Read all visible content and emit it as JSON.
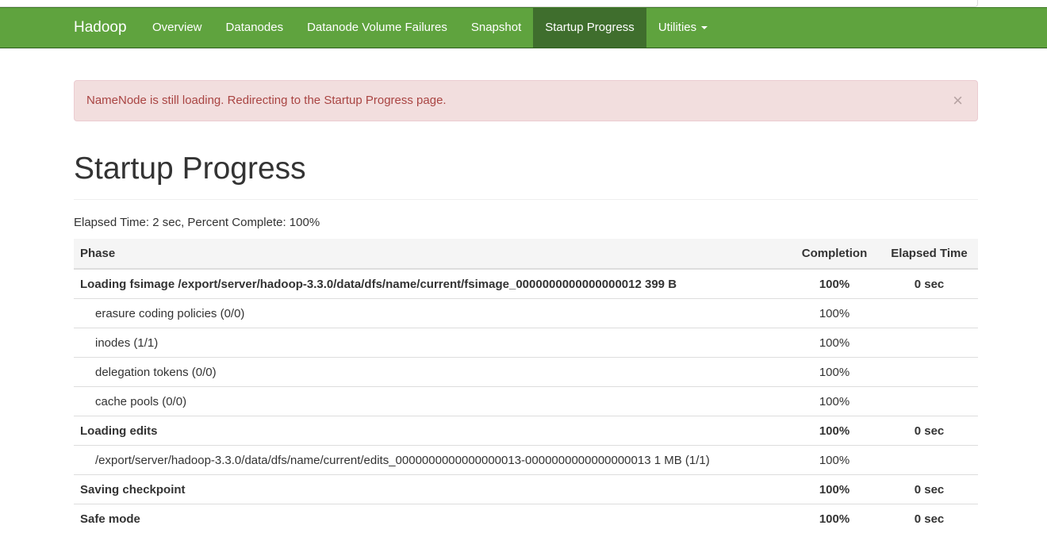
{
  "navbar": {
    "brand": "Hadoop",
    "links": [
      {
        "label": "Overview"
      },
      {
        "label": "Datanodes"
      },
      {
        "label": "Datanode Volume Failures"
      },
      {
        "label": "Snapshot"
      },
      {
        "label": "Startup Progress"
      },
      {
        "label": "Utilities"
      }
    ],
    "active": "Startup Progress",
    "color": "#5fa33e"
  },
  "alert": {
    "message": "NameNode is still loading. Redirecting to the Startup Progress page.",
    "close": "×"
  },
  "page_title": "Startup Progress",
  "summary": "Elapsed Time: 2 sec, Percent Complete: 100%",
  "table": {
    "headers": {
      "phase": "Phase",
      "completion": "Completion",
      "elapsed": "Elapsed Time"
    },
    "rows": [
      {
        "kind": "phase",
        "name": "Loading fsimage /export/server/hadoop-3.3.0/data/dfs/name/current/fsimage_0000000000000000012 399 B",
        "completion": "100%",
        "elapsed": "0 sec"
      },
      {
        "kind": "step",
        "name": "erasure coding policies (0/0)",
        "completion": "100%",
        "elapsed": ""
      },
      {
        "kind": "step",
        "name": "inodes (1/1)",
        "completion": "100%",
        "elapsed": ""
      },
      {
        "kind": "step",
        "name": "delegation tokens (0/0)",
        "completion": "100%",
        "elapsed": ""
      },
      {
        "kind": "step",
        "name": "cache pools (0/0)",
        "completion": "100%",
        "elapsed": ""
      },
      {
        "kind": "phase",
        "name": "Loading edits",
        "completion": "100%",
        "elapsed": "0 sec"
      },
      {
        "kind": "step",
        "name": "/export/server/hadoop-3.3.0/data/dfs/name/current/edits_0000000000000000013-0000000000000000013 1 MB (1/1)",
        "completion": "100%",
        "elapsed": ""
      },
      {
        "kind": "phase",
        "name": "Saving checkpoint",
        "completion": "100%",
        "elapsed": "0 sec"
      },
      {
        "kind": "phase",
        "name": "Safe mode",
        "completion": "100%",
        "elapsed": "0 sec"
      }
    ]
  }
}
